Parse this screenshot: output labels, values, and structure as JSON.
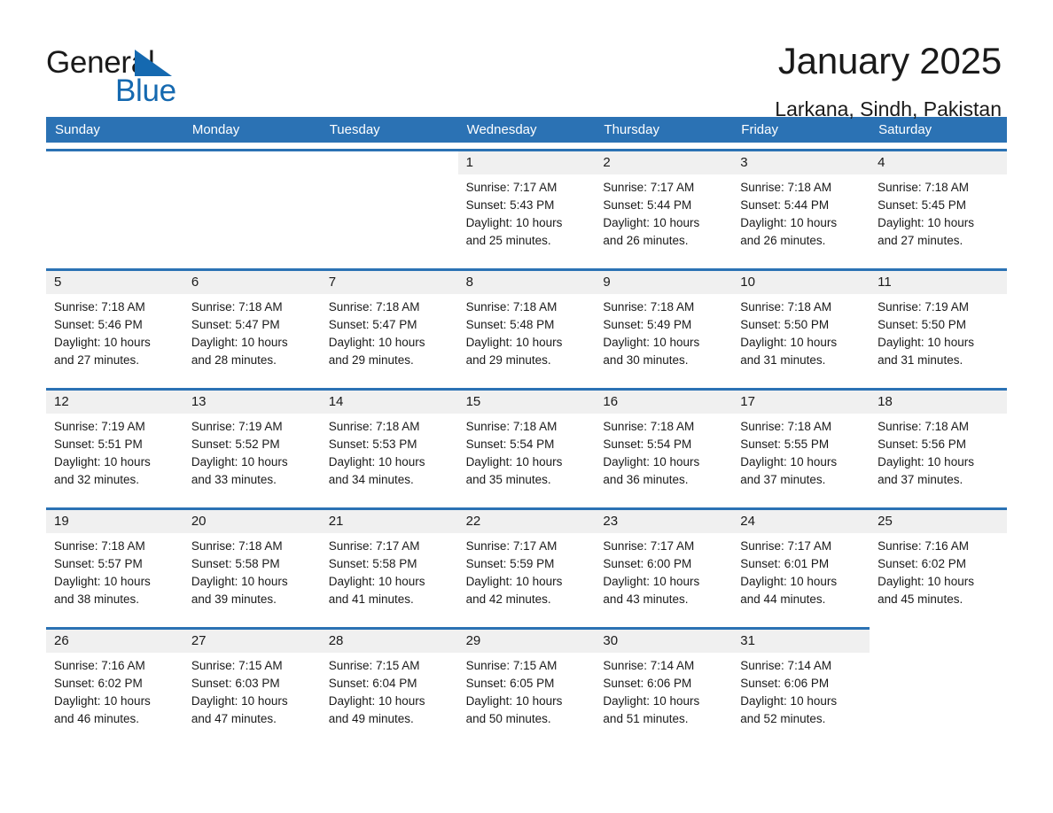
{
  "brand": {
    "word1": "General",
    "word2": "Blue",
    "triangle_color": "#1569b0"
  },
  "header": {
    "month_title": "January 2025",
    "location": "Larkana, Sindh, Pakistan"
  },
  "colors": {
    "header_blue": "#2b72b4",
    "row_rule_blue": "#2b72b4",
    "daynum_band": "#f0f0f0",
    "text": "#1a1a1a"
  },
  "weekdays": [
    "Sunday",
    "Monday",
    "Tuesday",
    "Wednesday",
    "Thursday",
    "Friday",
    "Saturday"
  ],
  "weeks": [
    [
      {
        "day": "",
        "sunrise": "",
        "sunset": "",
        "daylight1": "",
        "daylight2": ""
      },
      {
        "day": "",
        "sunrise": "",
        "sunset": "",
        "daylight1": "",
        "daylight2": ""
      },
      {
        "day": "",
        "sunrise": "",
        "sunset": "",
        "daylight1": "",
        "daylight2": ""
      },
      {
        "day": "1",
        "sunrise": "Sunrise: 7:17 AM",
        "sunset": "Sunset: 5:43 PM",
        "daylight1": "Daylight: 10 hours",
        "daylight2": "and 25 minutes."
      },
      {
        "day": "2",
        "sunrise": "Sunrise: 7:17 AM",
        "sunset": "Sunset: 5:44 PM",
        "daylight1": "Daylight: 10 hours",
        "daylight2": "and 26 minutes."
      },
      {
        "day": "3",
        "sunrise": "Sunrise: 7:18 AM",
        "sunset": "Sunset: 5:44 PM",
        "daylight1": "Daylight: 10 hours",
        "daylight2": "and 26 minutes."
      },
      {
        "day": "4",
        "sunrise": "Sunrise: 7:18 AM",
        "sunset": "Sunset: 5:45 PM",
        "daylight1": "Daylight: 10 hours",
        "daylight2": "and 27 minutes."
      }
    ],
    [
      {
        "day": "5",
        "sunrise": "Sunrise: 7:18 AM",
        "sunset": "Sunset: 5:46 PM",
        "daylight1": "Daylight: 10 hours",
        "daylight2": "and 27 minutes."
      },
      {
        "day": "6",
        "sunrise": "Sunrise: 7:18 AM",
        "sunset": "Sunset: 5:47 PM",
        "daylight1": "Daylight: 10 hours",
        "daylight2": "and 28 minutes."
      },
      {
        "day": "7",
        "sunrise": "Sunrise: 7:18 AM",
        "sunset": "Sunset: 5:47 PM",
        "daylight1": "Daylight: 10 hours",
        "daylight2": "and 29 minutes."
      },
      {
        "day": "8",
        "sunrise": "Sunrise: 7:18 AM",
        "sunset": "Sunset: 5:48 PM",
        "daylight1": "Daylight: 10 hours",
        "daylight2": "and 29 minutes."
      },
      {
        "day": "9",
        "sunrise": "Sunrise: 7:18 AM",
        "sunset": "Sunset: 5:49 PM",
        "daylight1": "Daylight: 10 hours",
        "daylight2": "and 30 minutes."
      },
      {
        "day": "10",
        "sunrise": "Sunrise: 7:18 AM",
        "sunset": "Sunset: 5:50 PM",
        "daylight1": "Daylight: 10 hours",
        "daylight2": "and 31 minutes."
      },
      {
        "day": "11",
        "sunrise": "Sunrise: 7:19 AM",
        "sunset": "Sunset: 5:50 PM",
        "daylight1": "Daylight: 10 hours",
        "daylight2": "and 31 minutes."
      }
    ],
    [
      {
        "day": "12",
        "sunrise": "Sunrise: 7:19 AM",
        "sunset": "Sunset: 5:51 PM",
        "daylight1": "Daylight: 10 hours",
        "daylight2": "and 32 minutes."
      },
      {
        "day": "13",
        "sunrise": "Sunrise: 7:19 AM",
        "sunset": "Sunset: 5:52 PM",
        "daylight1": "Daylight: 10 hours",
        "daylight2": "and 33 minutes."
      },
      {
        "day": "14",
        "sunrise": "Sunrise: 7:18 AM",
        "sunset": "Sunset: 5:53 PM",
        "daylight1": "Daylight: 10 hours",
        "daylight2": "and 34 minutes."
      },
      {
        "day": "15",
        "sunrise": "Sunrise: 7:18 AM",
        "sunset": "Sunset: 5:54 PM",
        "daylight1": "Daylight: 10 hours",
        "daylight2": "and 35 minutes."
      },
      {
        "day": "16",
        "sunrise": "Sunrise: 7:18 AM",
        "sunset": "Sunset: 5:54 PM",
        "daylight1": "Daylight: 10 hours",
        "daylight2": "and 36 minutes."
      },
      {
        "day": "17",
        "sunrise": "Sunrise: 7:18 AM",
        "sunset": "Sunset: 5:55 PM",
        "daylight1": "Daylight: 10 hours",
        "daylight2": "and 37 minutes."
      },
      {
        "day": "18",
        "sunrise": "Sunrise: 7:18 AM",
        "sunset": "Sunset: 5:56 PM",
        "daylight1": "Daylight: 10 hours",
        "daylight2": "and 37 minutes."
      }
    ],
    [
      {
        "day": "19",
        "sunrise": "Sunrise: 7:18 AM",
        "sunset": "Sunset: 5:57 PM",
        "daylight1": "Daylight: 10 hours",
        "daylight2": "and 38 minutes."
      },
      {
        "day": "20",
        "sunrise": "Sunrise: 7:18 AM",
        "sunset": "Sunset: 5:58 PM",
        "daylight1": "Daylight: 10 hours",
        "daylight2": "and 39 minutes."
      },
      {
        "day": "21",
        "sunrise": "Sunrise: 7:17 AM",
        "sunset": "Sunset: 5:58 PM",
        "daylight1": "Daylight: 10 hours",
        "daylight2": "and 41 minutes."
      },
      {
        "day": "22",
        "sunrise": "Sunrise: 7:17 AM",
        "sunset": "Sunset: 5:59 PM",
        "daylight1": "Daylight: 10 hours",
        "daylight2": "and 42 minutes."
      },
      {
        "day": "23",
        "sunrise": "Sunrise: 7:17 AM",
        "sunset": "Sunset: 6:00 PM",
        "daylight1": "Daylight: 10 hours",
        "daylight2": "and 43 minutes."
      },
      {
        "day": "24",
        "sunrise": "Sunrise: 7:17 AM",
        "sunset": "Sunset: 6:01 PM",
        "daylight1": "Daylight: 10 hours",
        "daylight2": "and 44 minutes."
      },
      {
        "day": "25",
        "sunrise": "Sunrise: 7:16 AM",
        "sunset": "Sunset: 6:02 PM",
        "daylight1": "Daylight: 10 hours",
        "daylight2": "and 45 minutes."
      }
    ],
    [
      {
        "day": "26",
        "sunrise": "Sunrise: 7:16 AM",
        "sunset": "Sunset: 6:02 PM",
        "daylight1": "Daylight: 10 hours",
        "daylight2": "and 46 minutes."
      },
      {
        "day": "27",
        "sunrise": "Sunrise: 7:15 AM",
        "sunset": "Sunset: 6:03 PM",
        "daylight1": "Daylight: 10 hours",
        "daylight2": "and 47 minutes."
      },
      {
        "day": "28",
        "sunrise": "Sunrise: 7:15 AM",
        "sunset": "Sunset: 6:04 PM",
        "daylight1": "Daylight: 10 hours",
        "daylight2": "and 49 minutes."
      },
      {
        "day": "29",
        "sunrise": "Sunrise: 7:15 AM",
        "sunset": "Sunset: 6:05 PM",
        "daylight1": "Daylight: 10 hours",
        "daylight2": "and 50 minutes."
      },
      {
        "day": "30",
        "sunrise": "Sunrise: 7:14 AM",
        "sunset": "Sunset: 6:06 PM",
        "daylight1": "Daylight: 10 hours",
        "daylight2": "and 51 minutes."
      },
      {
        "day": "31",
        "sunrise": "Sunrise: 7:14 AM",
        "sunset": "Sunset: 6:06 PM",
        "daylight1": "Daylight: 10 hours",
        "daylight2": "and 52 minutes."
      },
      {
        "day": "",
        "sunrise": "",
        "sunset": "",
        "daylight1": "",
        "daylight2": ""
      }
    ]
  ]
}
